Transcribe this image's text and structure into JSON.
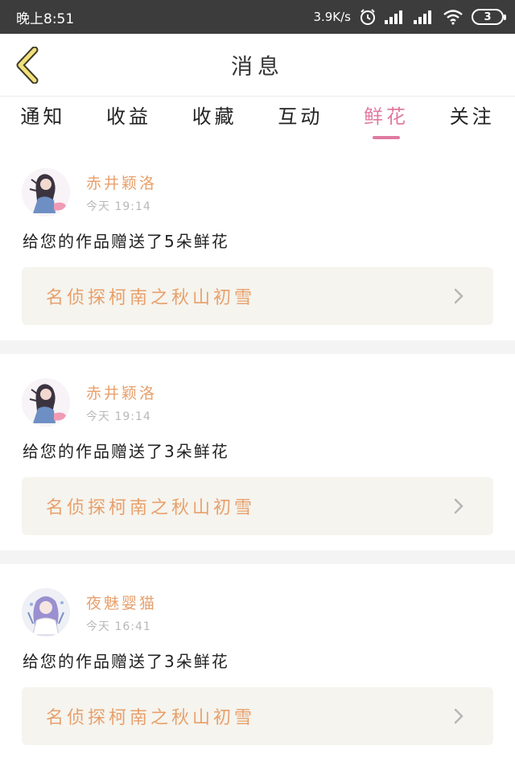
{
  "status_bar": {
    "time": "晚上8:51",
    "net_speed": "3.9K/s",
    "battery": "3"
  },
  "header": {
    "title": "消息"
  },
  "tabs": [
    {
      "label": "通知",
      "active": false
    },
    {
      "label": "收益",
      "active": false
    },
    {
      "label": "收藏",
      "active": false
    },
    {
      "label": "互动",
      "active": false
    },
    {
      "label": "鲜花",
      "active": true
    },
    {
      "label": "关注",
      "active": false
    }
  ],
  "messages": [
    {
      "user": "赤井颖洛",
      "time": "今天 19:14",
      "text": "给您的作品赠送了5朵鲜花",
      "work_title": "名侦探柯南之秋山初雪"
    },
    {
      "user": "赤井颖洛",
      "time": "今天 19:14",
      "text": "给您的作品赠送了3朵鲜花",
      "work_title": "名侦探柯南之秋山初雪"
    },
    {
      "user": "夜魅婴猫",
      "time": "今天 16:41",
      "text": "给您的作品赠送了3朵鲜花",
      "work_title": "名侦探柯南之秋山初雪"
    }
  ],
  "colors": {
    "accent_pink": "#e07aa0",
    "username_orange": "#e8a06c",
    "back_arrow_yellow": "#f2e07a",
    "card_bg": "#f5f4ee"
  }
}
